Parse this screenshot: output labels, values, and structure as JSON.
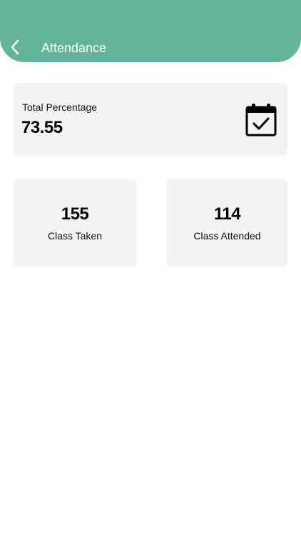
{
  "header": {
    "title": "Attendance",
    "back_icon": "chevron-left-icon",
    "background_color": "#63b597"
  },
  "summary": {
    "label": "Total Percentage",
    "value": "73.55",
    "icon": "calendar-check-icon"
  },
  "stats": [
    {
      "value": "155",
      "label": "Class Taken"
    },
    {
      "value": "114",
      "label": "Class Attended"
    }
  ],
  "colors": {
    "card_background": "#f3f4f6",
    "header_text": "#ffffff",
    "body_text": "#000000"
  }
}
